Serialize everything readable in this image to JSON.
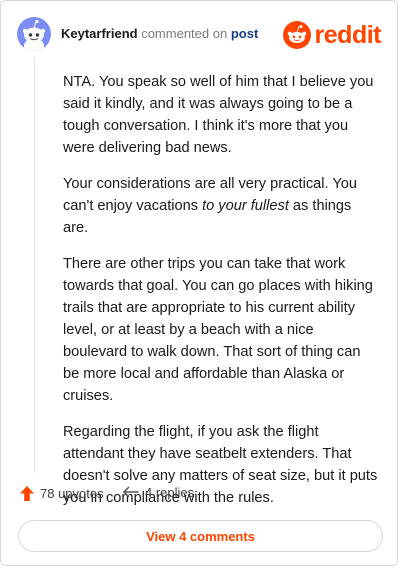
{
  "comment": {
    "username": "Keytarfriend",
    "action_text": "commented on",
    "post_link": "post",
    "brand": "reddit",
    "paragraphs": [
      {
        "text": "NTA. You speak so well of him that I believe you said it kindly, and it was always going to be a tough conversation. I think it's more that you were delivering bad news."
      },
      {
        "before": "Your considerations are all very practical. You can't enjoy vacations ",
        "em": "to your fullest",
        "after": " as things are."
      },
      {
        "text": "There are other trips you can take that work towards that goal. You can go places with hiking trails that are appropriate to his current ability level, or at least by a beach with a nice boulevard to walk down. That sort of thing can be more local and affordable than Alaska or cruises."
      },
      {
        "text": "Regarding the flight, if you ask the flight attendant they have seatbelt extenders. That doesn't solve any matters of seat size, but it puts you in compliance with the rules."
      }
    ]
  },
  "footer": {
    "upvotes_label": "78 upvotes",
    "replies_label": "4 replies",
    "view_comments_label": "View 4 comments"
  },
  "icons": {
    "avatar": "snoo-avatar-icon",
    "logo": "reddit-snoo-icon",
    "upvote": "upvote-arrow-icon",
    "reply": "reply-arrow-icon"
  },
  "colors": {
    "brand": "#ff4500",
    "avatar_bg": "#7b8df3",
    "link": "#1a3e8c",
    "text": "#1a1a1b"
  }
}
